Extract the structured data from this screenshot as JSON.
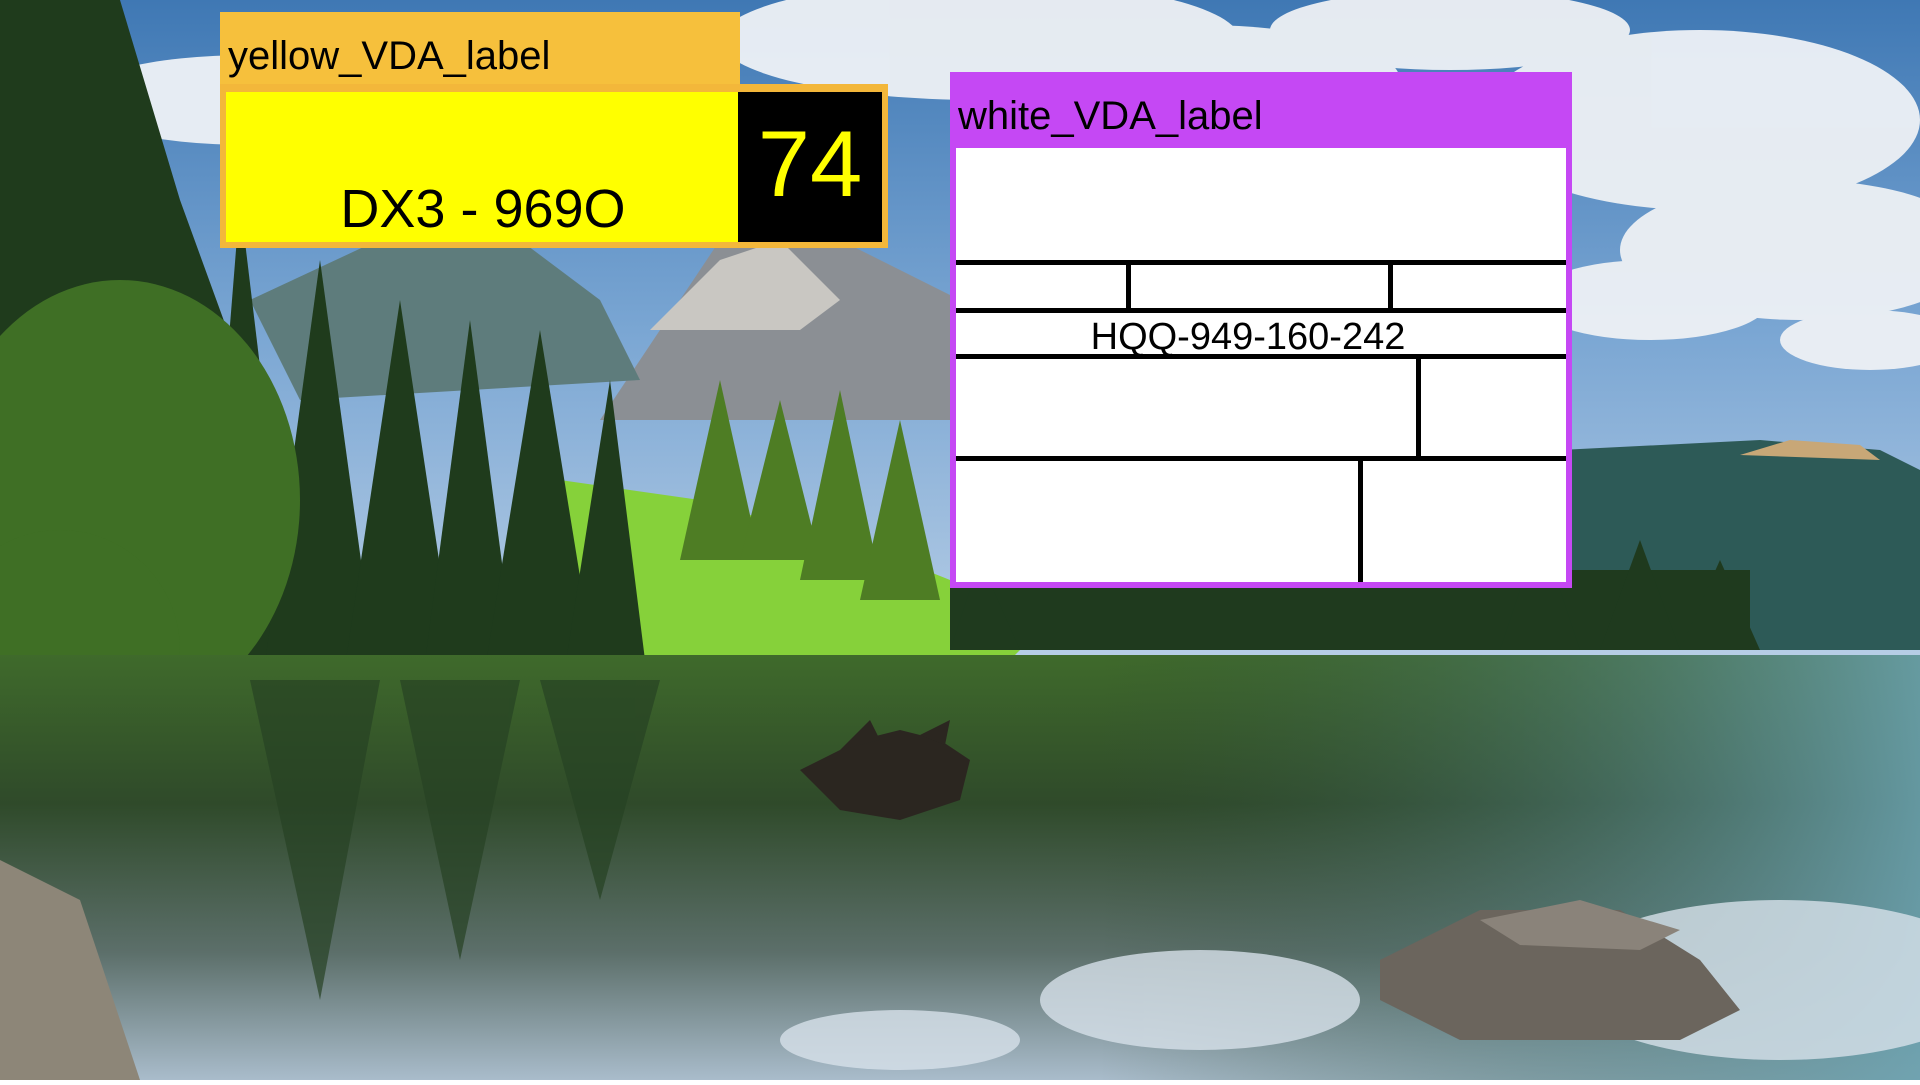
{
  "scene": {
    "background_description_colors": {
      "sky": "#6a97c6",
      "cloud": "#eef1f5",
      "forest_dark": "#1f3b1c",
      "forest_light": "#5ea42d",
      "meadow": "#86d13a",
      "mountain": "#8b8f94",
      "lake": "#2e4a38",
      "water_reflection": "#bcd0e3"
    }
  },
  "yellow_label": {
    "title": "yellow_VDA_label",
    "plate_text": "DX3 - 969O",
    "number": "74",
    "colors": {
      "title_bg": "#f6c03c",
      "plate_bg": "#ffff00",
      "number_bg": "#000000",
      "number_fg": "#ffff00"
    }
  },
  "white_label": {
    "title": "white_VDA_label",
    "code": "HQQ-949-160-242",
    "colors": {
      "frame": "#c548f4",
      "panel": "#ffffff",
      "lines": "#000000"
    }
  }
}
